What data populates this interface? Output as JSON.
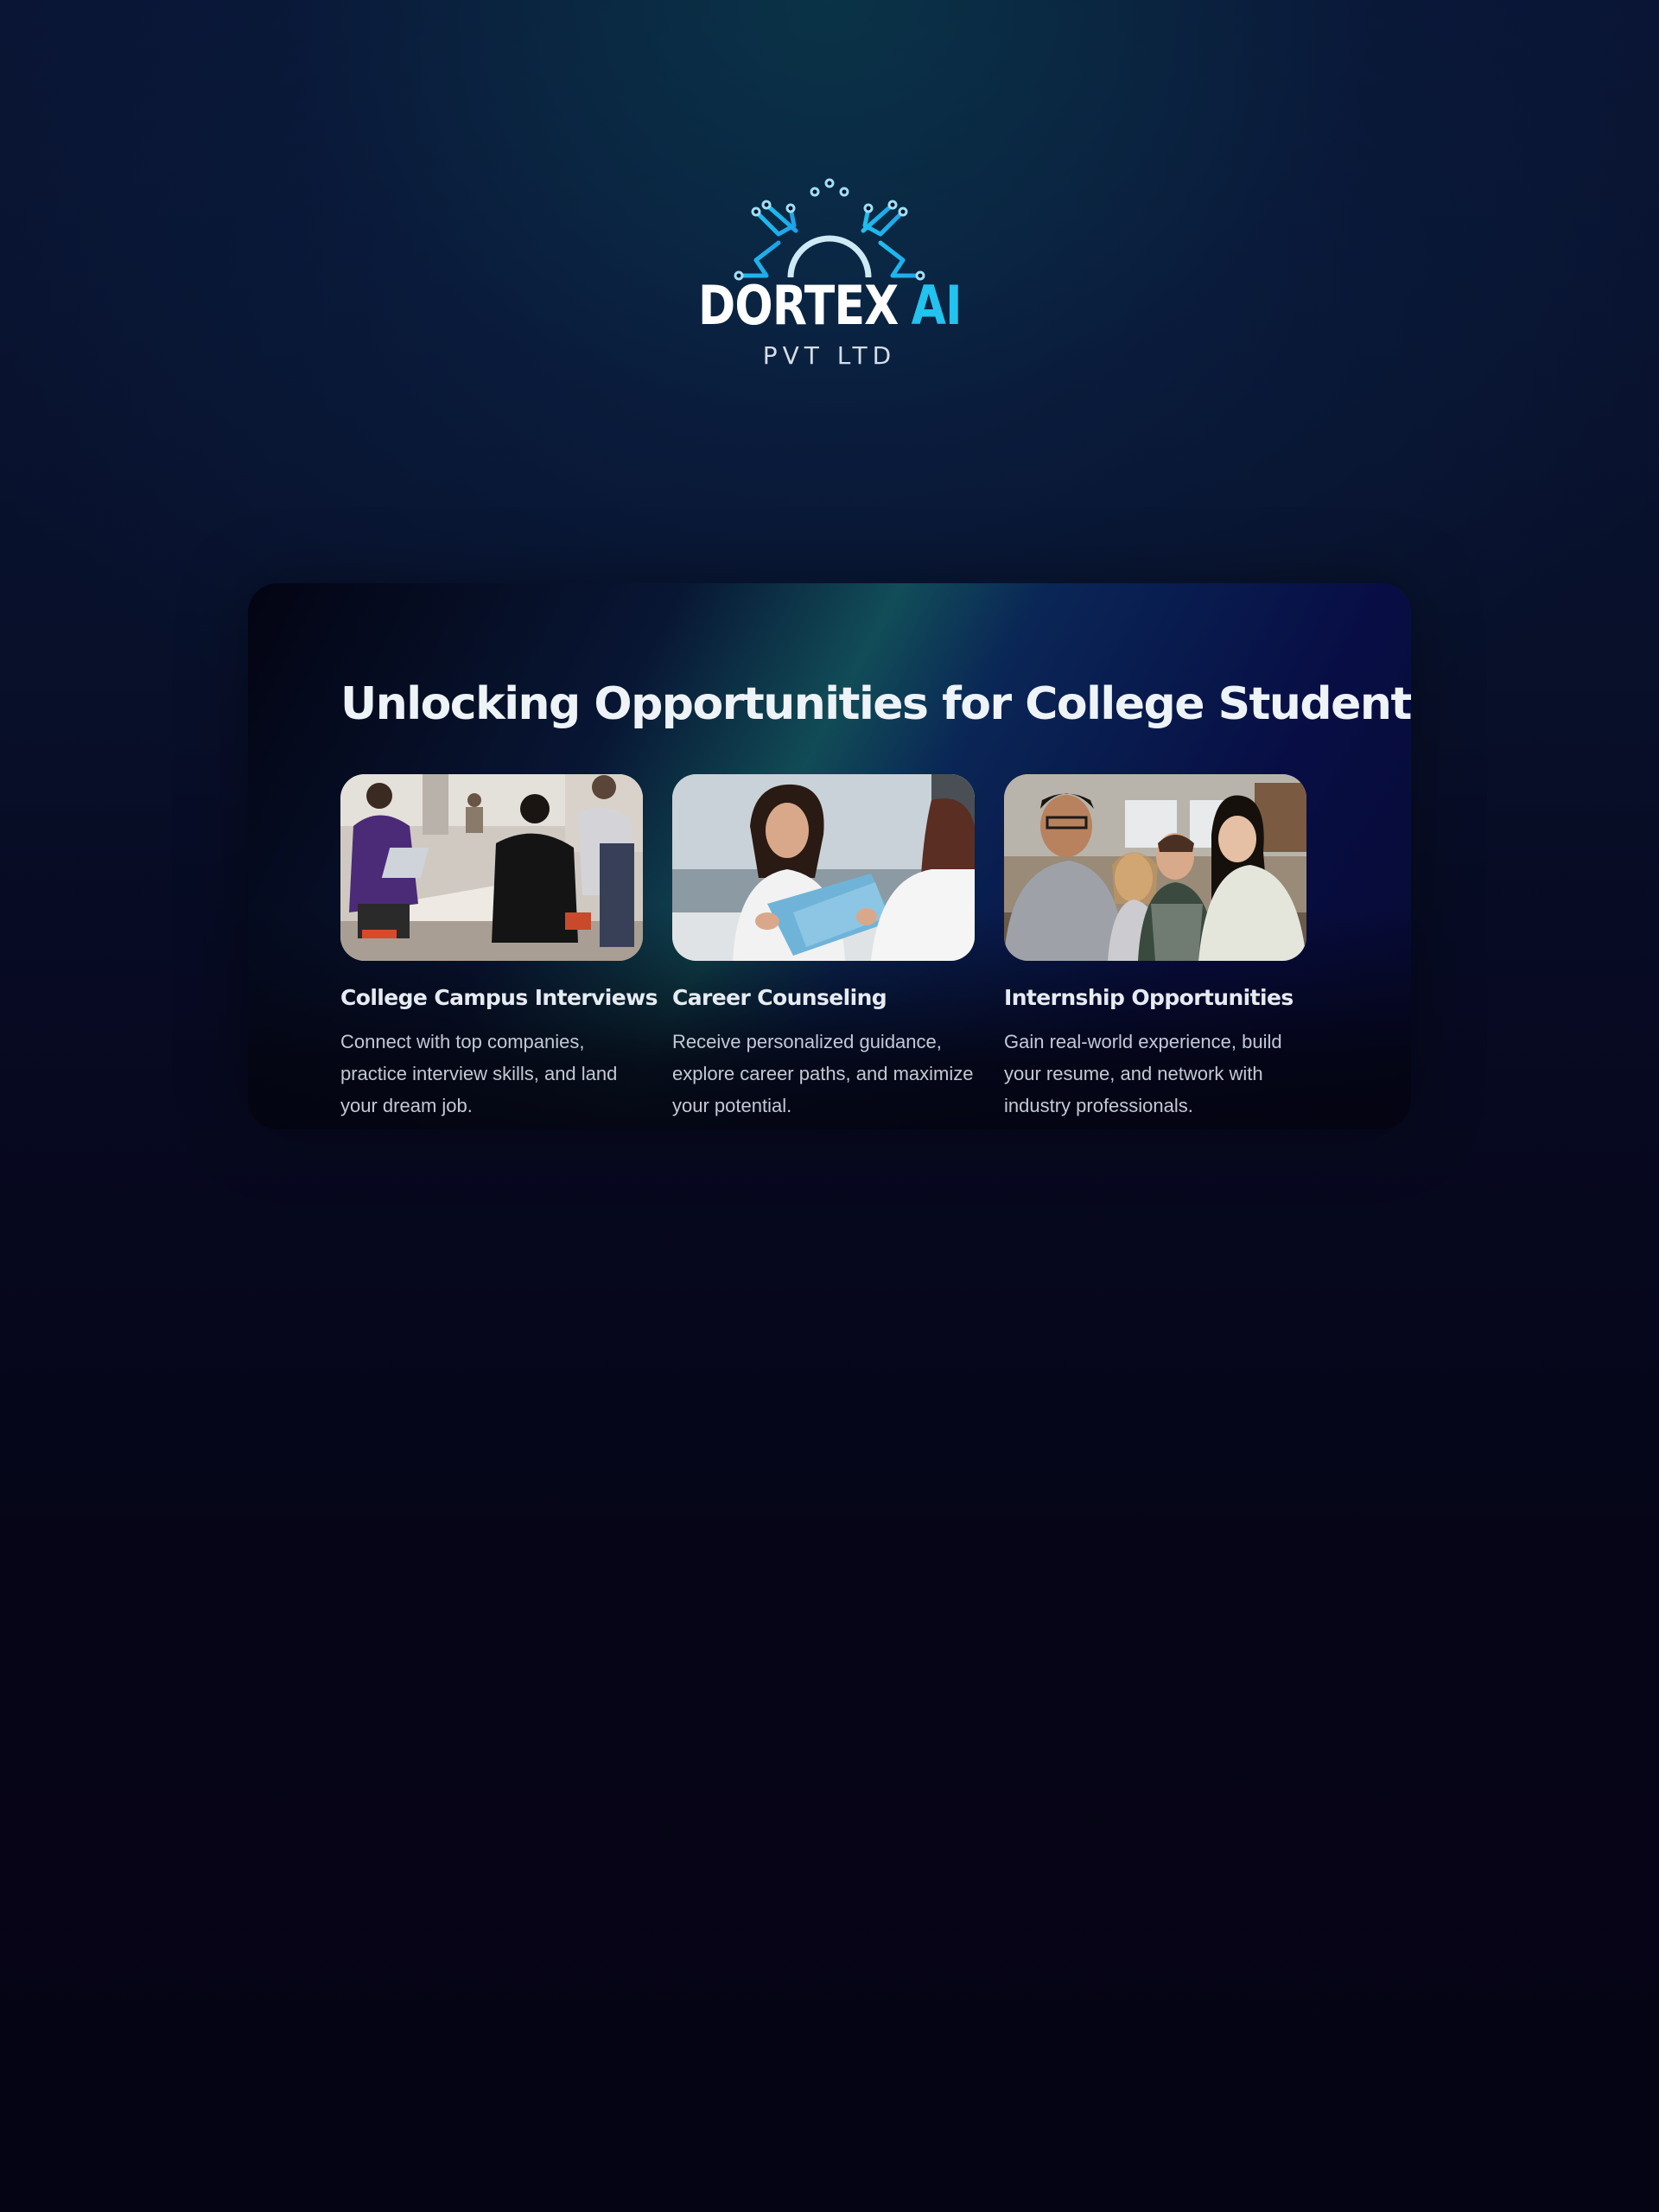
{
  "logo": {
    "name_primary": "DORTEX",
    "name_accent": "AI",
    "suffix": "PVT LTD",
    "accent_color": "#22c3ee"
  },
  "section": {
    "title": "Unlocking Opportunities for College Students"
  },
  "features": [
    {
      "title": "College Campus Interviews",
      "description": "Connect with top companies, practice interview skills, and land your dream job.",
      "image": "photo-students-interview-table"
    },
    {
      "title": "Career Counseling",
      "description": "Receive personalized guidance, explore career paths, and maximize your potential.",
      "image": "photo-counselor-with-folder"
    },
    {
      "title": "Internship Opportunities",
      "description": "Gain real-world experience, build your resume, and network with industry professionals.",
      "image": "photo-smiling-student-group"
    }
  ]
}
